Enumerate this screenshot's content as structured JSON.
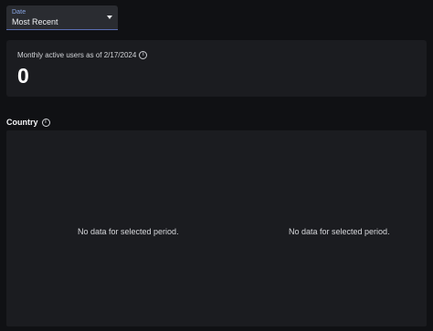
{
  "date_filter": {
    "label": "Date",
    "value": "Most Recent",
    "caret_icon": "caret-down-icon"
  },
  "mau_card": {
    "title": "Monthly active users as of 2/17/2024",
    "info_icon": "info-icon",
    "value": "0"
  },
  "country_section": {
    "title": "Country",
    "info_icon": "info-icon",
    "empty_left": "No data for selected period.",
    "empty_right": "No data for selected period."
  },
  "colors": {
    "background": "#101114",
    "card": "#1b1c20",
    "select_bg": "#2a2c31",
    "accent": "#8aa8e8"
  }
}
